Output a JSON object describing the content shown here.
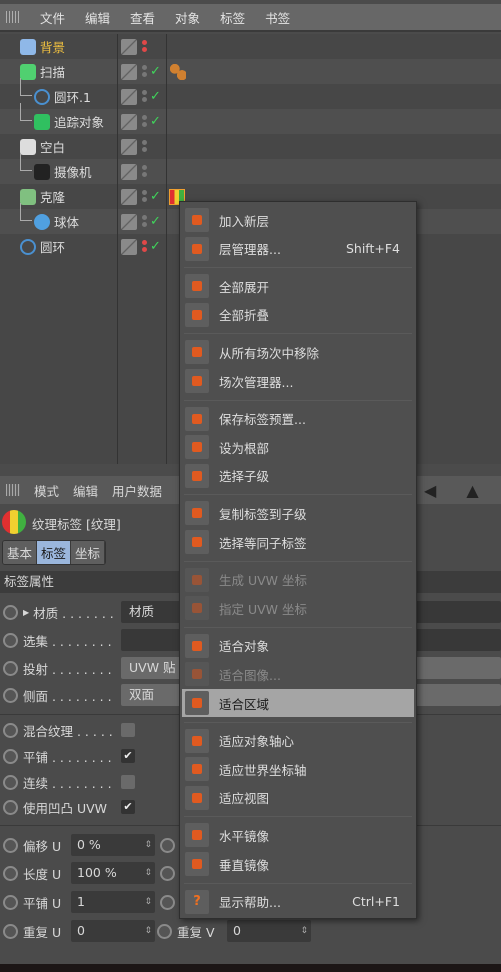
{
  "menubar": [
    "文件",
    "编辑",
    "查看",
    "对象",
    "标签",
    "书签"
  ],
  "objects": [
    {
      "name": "背景",
      "color": "#f0c040",
      "check": false,
      "dots": "red"
    },
    {
      "name": "扫描",
      "check": true,
      "tag": "sweep"
    },
    {
      "name": "圆环.1",
      "check": true
    },
    {
      "name": "追踪对象",
      "check": true
    },
    {
      "name": "空白",
      "check": false
    },
    {
      "name": "摄像机",
      "check": false
    },
    {
      "name": "克隆",
      "check": true,
      "tag": "texture"
    },
    {
      "name": "球体",
      "check": true
    },
    {
      "name": "圆环",
      "check": true,
      "dots": "red"
    }
  ],
  "context_menu": [
    {
      "label": "加入新层",
      "icon": "layer-add"
    },
    {
      "label": "层管理器...",
      "shortcut": "Shift+F4",
      "icon": "layer-manager"
    },
    {
      "sep": true
    },
    {
      "label": "全部展开",
      "icon": "expand-all"
    },
    {
      "label": "全部折叠",
      "icon": "collapse-all"
    },
    {
      "sep": true
    },
    {
      "label": "从所有场次中移除",
      "icon": "remove-takes"
    },
    {
      "label": "场次管理器...",
      "icon": "take-manager"
    },
    {
      "sep": true
    },
    {
      "label": "保存标签预置...",
      "icon": "save-preset"
    },
    {
      "label": "设为根部",
      "icon": "set-root"
    },
    {
      "label": "选择子级",
      "icon": "select-children"
    },
    {
      "sep": true
    },
    {
      "label": "复制标签到子级",
      "icon": "copy-tag"
    },
    {
      "label": "选择等同子标签",
      "icon": "select-identical"
    },
    {
      "sep": true
    },
    {
      "label": "生成 UVW 坐标",
      "icon": "generate-uvw",
      "disabled": true
    },
    {
      "label": "指定 UVW 坐标",
      "icon": "assign-uvw",
      "disabled": true
    },
    {
      "sep": true
    },
    {
      "label": "适合对象",
      "icon": "fit-object"
    },
    {
      "label": "适合图像...",
      "icon": "fit-image",
      "disabled": true
    },
    {
      "label": "适合区域",
      "icon": "fit-region",
      "highlighted": true
    },
    {
      "sep": true
    },
    {
      "label": "适应对象轴心",
      "icon": "fit-object-axis"
    },
    {
      "label": "适应世界坐标轴",
      "icon": "fit-world-axis"
    },
    {
      "label": "适应视图",
      "icon": "fit-view"
    },
    {
      "sep": true
    },
    {
      "label": "水平镜像",
      "icon": "mirror-h"
    },
    {
      "label": "垂直镜像",
      "icon": "mirror-v"
    },
    {
      "sep": true
    },
    {
      "label": "显示帮助...",
      "shortcut": "Ctrl+F1",
      "icon": "help"
    }
  ],
  "attr": {
    "menubar": [
      "模式",
      "编辑",
      "用户数据"
    ],
    "title": "纹理标签 [纹理]",
    "tabs": [
      "基本",
      "标签",
      "坐标"
    ],
    "active_tab": "标签",
    "section": "标签属性",
    "material_label": "材质 . . . . . . .",
    "material_value": "材质",
    "selection_label": "选集 . . . . . . . .",
    "projection_label": "投射 . . . . . . . .",
    "projection_value": "UVW 贴",
    "side_label": "侧面 . . . . . . . .",
    "side_value": "双面",
    "blend_label": "混合纹理 . . . . .",
    "blend": false,
    "tile_label": "平铺 . . . . . . . .",
    "tile": true,
    "seamless_label": "连续 . . . . . . . .",
    "seamless": false,
    "bump_label": "使用凹凸 UVW",
    "bump": true,
    "offset_u_label": "偏移 U",
    "offset_u": "0 %",
    "length_u_label": "长度 U",
    "length_u": "100 %",
    "tiles_u_label": "平铺 U",
    "tiles_u": "1",
    "repeat_u_label": "重复 U",
    "repeat_u": "0",
    "repeat_v_label": "重复 V",
    "repeat_v": "0"
  }
}
